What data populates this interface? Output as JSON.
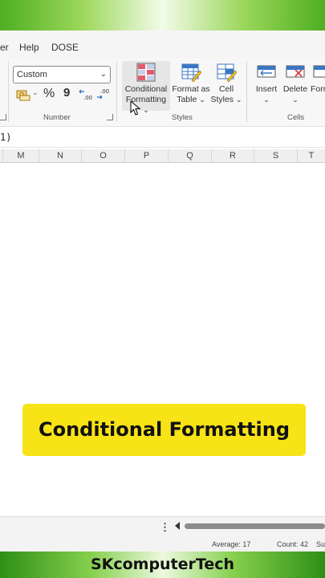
{
  "menu": {
    "partial_left": "er",
    "help": "Help",
    "dose": "DOSE"
  },
  "number_group": {
    "format_value": "Custom",
    "currency_symbol": "₹",
    "percent": "%",
    "comma": "9",
    "increase_decimal": ".00",
    "decrease_decimal": ".00",
    "label": "Number"
  },
  "styles_group": {
    "conditional_formatting_line1": "Conditional",
    "conditional_formatting_line2": "Formatting",
    "format_as_table_line1": "Format as",
    "format_as_table_line2": "Table",
    "cell_styles_line1": "Cell",
    "cell_styles_line2": "Styles",
    "label": "Styles"
  },
  "cells_group": {
    "insert": "Insert",
    "delete": "Delete",
    "format_partial": "Forr",
    "label": "Cells"
  },
  "formula_bar": {
    "text": "1)"
  },
  "columns": [
    "M",
    "N",
    "O",
    "P",
    "Q",
    "R",
    "S",
    "T"
  ],
  "banner": {
    "text": "Conditional Formatting"
  },
  "status": {
    "average": "Average: 17",
    "count": "Count: 42",
    "sum_partial": "Sum"
  },
  "brand": {
    "text": "SKcomputerTech"
  },
  "colors": {
    "banner": "#f7e316",
    "brand_green": "#4fae21",
    "ribbon_bg": "#f7f7f7"
  }
}
